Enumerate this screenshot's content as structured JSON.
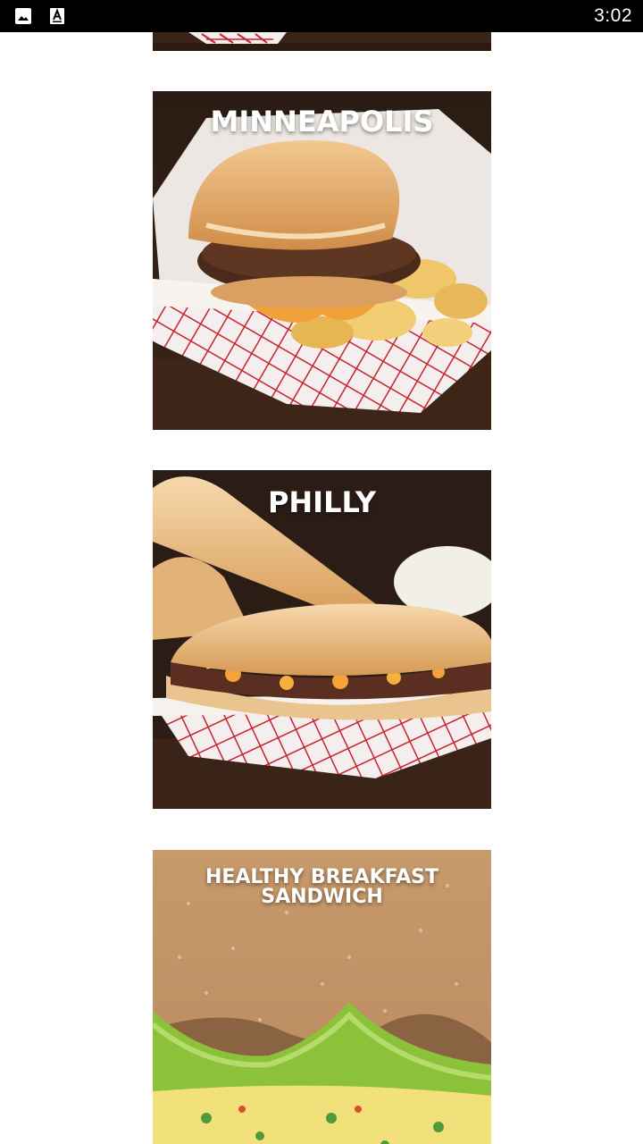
{
  "status_bar": {
    "time": "3:02",
    "icons": [
      "image-icon",
      "font-icon"
    ]
  },
  "feed": {
    "cards": [
      {
        "title": ""
      },
      {
        "title": "MINNEAPOLIS"
      },
      {
        "title": "PHILLY"
      },
      {
        "title_line1": "HEALTHY BREAKFAST",
        "title_line2": "SANDWICH"
      }
    ]
  },
  "colors": {
    "status_bar_bg": "#000000",
    "page_bg": "#ffffff",
    "title_text": "#ffffff"
  }
}
